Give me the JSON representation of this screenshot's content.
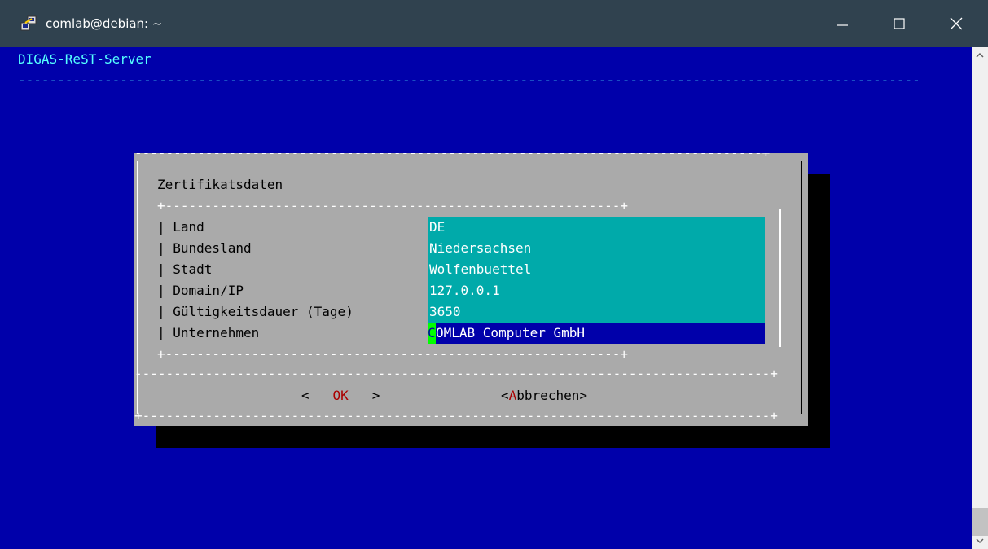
{
  "window": {
    "title": "comlab@debian: ~"
  },
  "terminal": {
    "header": "DIGAS-ReST-Server",
    "header_rule": "-------------------------------------------------------------------------------------------------------------------"
  },
  "dialog": {
    "title": "Zertifikatsdaten",
    "fields": [
      {
        "label": "Land",
        "value": "DE"
      },
      {
        "label": "Bundesland",
        "value": "Niedersachsen"
      },
      {
        "label": "Stadt",
        "value": "Wolfenbuettel"
      },
      {
        "label": "Domain/IP",
        "value": "127.0.0.1"
      },
      {
        "label": "Gültigkeitsdauer (Tage)",
        "value": "3650"
      },
      {
        "label": "Unternehmen",
        "value_first": "C",
        "value_rest": "OMLAB Computer GmbH"
      }
    ],
    "ok_button": {
      "left": "<",
      "label": "OK",
      "right": ">"
    },
    "cancel_button": {
      "left": "<",
      "hot": "A",
      "rest": "bbrechen",
      "right": ">"
    }
  },
  "colors": {
    "terminal_bg": "#0000aa",
    "header_text": "#55ffff",
    "dialog_bg": "#aaaaaa",
    "field_bg": "#00aaaa",
    "active_field_bg": "#0000aa",
    "cursor": "#00ff00",
    "hotkey": "#aa0000"
  }
}
